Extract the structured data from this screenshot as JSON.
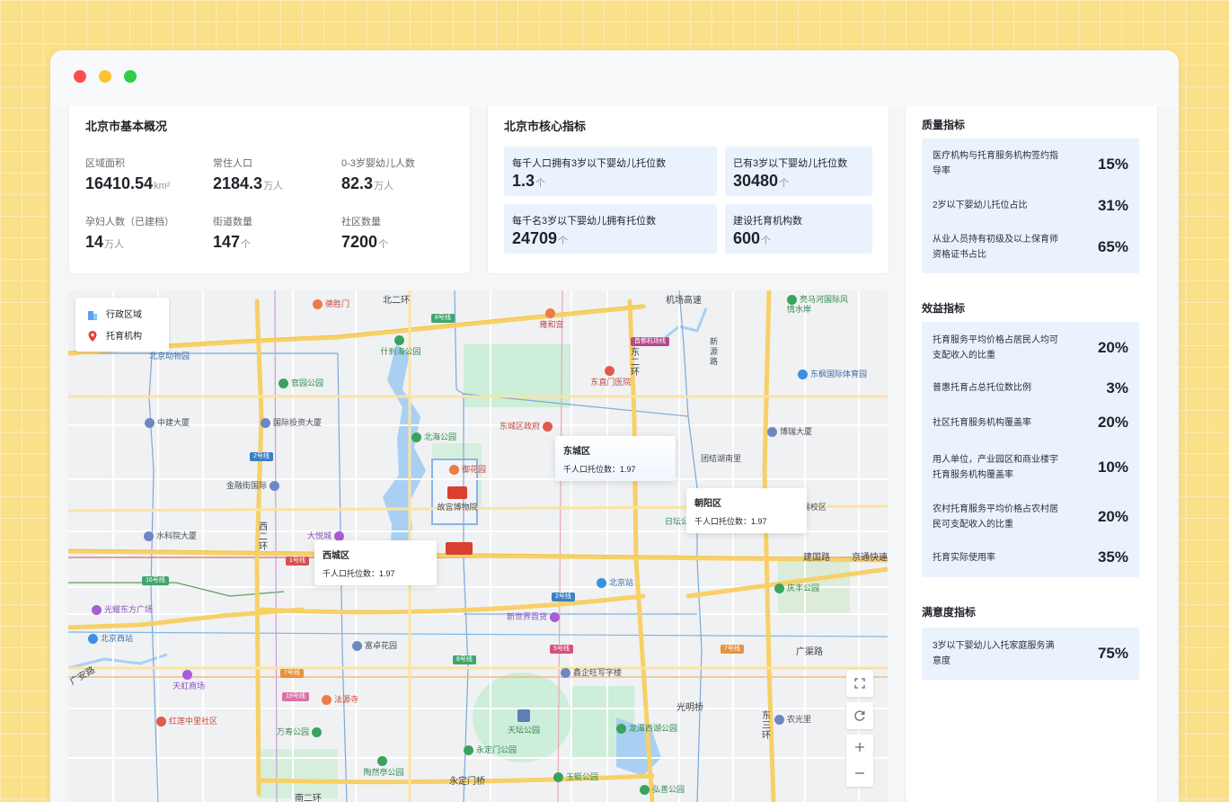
{
  "overview": {
    "title": "北京市基本概况",
    "stats": [
      {
        "label": "区域面积",
        "value": "16410.54",
        "unit": "km²"
      },
      {
        "label": "常住人口",
        "value": "2184.3",
        "unit": "万人"
      },
      {
        "label": "0-3岁婴幼儿人数",
        "value": "82.3",
        "unit": "万人"
      },
      {
        "label": "孕妇人数（已建档）",
        "value": "14",
        "unit": "万人"
      },
      {
        "label": "街道数量",
        "value": "147",
        "unit": "个"
      },
      {
        "label": "社区数量",
        "value": "7200",
        "unit": "个"
      }
    ]
  },
  "core": {
    "title": "北京市核心指标",
    "kpis": [
      {
        "label": "每千人口拥有3岁以下婴幼儿托位数",
        "value": "1.3",
        "unit": "个"
      },
      {
        "label": "已有3岁以下婴幼儿托位数",
        "value": "30480",
        "unit": "个"
      },
      {
        "label": "每千名3岁以下婴幼儿拥有托位数",
        "value": "24709",
        "unit": "个"
      },
      {
        "label": "建设托育机构数",
        "value": "600",
        "unit": "个"
      }
    ]
  },
  "quality": {
    "title": "质量指标",
    "items": [
      {
        "label": "医疗机构与托育服务机构签约指导率",
        "value": "15%"
      },
      {
        "label": "2岁以下婴幼儿托位占比",
        "value": "31%"
      },
      {
        "label": "从业人员持有初级及以上保育师资格证书占比",
        "value": "65%"
      }
    ]
  },
  "benefit": {
    "title": "效益指标",
    "items": [
      {
        "label": "托育服务平均价格占居民人均可支配收入的比重",
        "value": "20%"
      },
      {
        "label": "普惠托育占总托位数比例",
        "value": "3%"
      },
      {
        "label": "社区托育服务机构覆盖率",
        "value": "20%"
      },
      {
        "label": "用人单位，产业园区和商业楼宇托育服务机构覆盖率",
        "value": "10%"
      },
      {
        "label": "农村托育服务平均价格占农村居民可支配收入的比重",
        "value": "20%"
      },
      {
        "label": "托育实际使用率",
        "value": "35%"
      }
    ]
  },
  "satisfaction": {
    "title": "满意度指标",
    "items": [
      {
        "label": "3岁以下婴幼儿入托家庭服务满意度",
        "value": "75%"
      }
    ]
  },
  "map": {
    "legend": {
      "admin": "行政区域",
      "childcare": "托育机构"
    },
    "tooltips": [
      {
        "name": "东城区",
        "text": "千人口托位数：1.97"
      },
      {
        "name": "朝阳区",
        "text": "千人口托位数：1.97"
      },
      {
        "name": "西城区",
        "text": "千人口托位数：1.97"
      }
    ],
    "roads": {
      "north2": "北二环",
      "airport": "机场高速",
      "jianguo": "建国路",
      "jingtong": "京通快速",
      "guangqu": "广渠路",
      "east2": "东二环",
      "east3": "东三环",
      "west2": "西二环",
      "xinyuan": "新源路",
      "yongdingmen": "永定门桥",
      "guanganmen": "广安路",
      "guangmingqiao": "光明桥",
      "south2": "南二环"
    },
    "places": {
      "deshengmen": "德胜门",
      "yonghegong": "雍和宫",
      "xiaoma": "亮马河国际风情水岸",
      "zoo": "北京动物园",
      "shichahai": "什刹海公园",
      "dongzhimen": "东直门医院",
      "dongfeng": "东枫国际体育园",
      "guanyuan": "官园公园",
      "zhongjian": "中建大厦",
      "guotou": "国际投资大厦",
      "beihai": "北海公园",
      "dongcheng_gov": "东城区政府",
      "botai": "博瑞大厦",
      "yuhuayuan": "御花园",
      "tuanjiehu": "团结湖南里",
      "financial": "金融街国际",
      "gugong": "故宫博物院",
      "ritan": "日坛公园",
      "trade": "贸易校区",
      "shuike": "水科院大厦",
      "dayuecheng": "大悦城",
      "beijingzhan": "北京站",
      "qingfeng": "庆丰公园",
      "guangyao": "光耀东方广场",
      "xinshijie": "新世界百货",
      "beijingxi": "北京西站",
      "fuzhuo": "富卓花园",
      "xinqi": "鑫企旺写字楼",
      "tianhong": "天虹商场",
      "fayuansi": "法源寺",
      "hongliang": "红莲中里社区",
      "tiantan": "天坛公园",
      "longtan": "龙潭西湖公园",
      "nongguangli": "农光里",
      "wanshou": "万寿公园",
      "yongdingmenpark": "永定门公园",
      "taorantings": "陶然亭公园",
      "yutang": "玉蜓公园",
      "hongshan": "弘善公园"
    },
    "lines": {
      "l8": "8号线",
      "l2a": "2号线",
      "l2b": "2号线",
      "l1": "1号线",
      "l16": "16号线",
      "l5": "5号线",
      "l7": "7号线",
      "l7b": "7号线",
      "l19": "19号线",
      "l8b": "8号线",
      "l4": "4号线",
      "airport_line": "首都机场线"
    }
  },
  "colors": {
    "accent_bg": "#eaf3fd",
    "background": "#fbe08a",
    "road": "#f7d067"
  }
}
